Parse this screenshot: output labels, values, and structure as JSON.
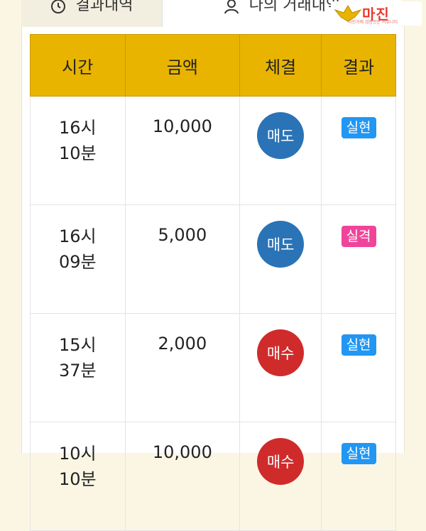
{
  "tabs": [
    {
      "label": "결과내역",
      "icon": "history-icon"
    },
    {
      "label": "나의 거래내역",
      "icon": "user-icon"
    }
  ],
  "logo": {
    "text": "마진",
    "sub": "마진거래 검증전문 커뮤니티"
  },
  "table": {
    "headers": [
      "시간",
      "금액",
      "체결",
      "결과"
    ],
    "rows": [
      {
        "hour": "16시",
        "minute": "10분",
        "amount": "10,000",
        "fill": "매도",
        "result": "실현"
      },
      {
        "hour": "16시",
        "minute": "09분",
        "amount": "5,000",
        "fill": "매도",
        "result": "실격"
      },
      {
        "hour": "15시",
        "minute": "37분",
        "amount": "2,000",
        "fill": "매수",
        "result": "실현"
      },
      {
        "hour": "10시",
        "minute": "10분",
        "amount": "10,000",
        "fill": "매수",
        "result": "실현"
      }
    ]
  },
  "colors": {
    "header": "#e8b400",
    "sell": "#2a73b6",
    "buy": "#d02b2b",
    "hit": "#2196f3",
    "miss": "#f0449a"
  }
}
